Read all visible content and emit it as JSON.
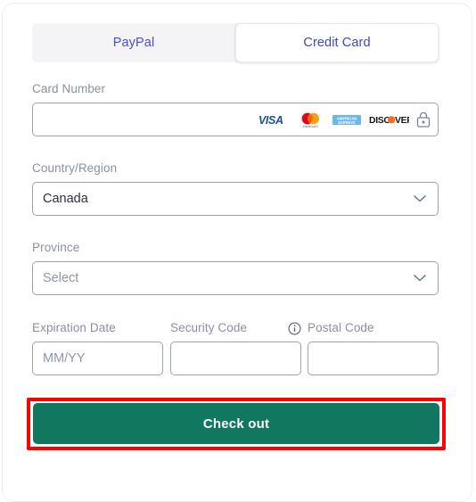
{
  "payment_form": {
    "tabs": [
      {
        "id": "paypal",
        "label": "PayPal",
        "active": false
      },
      {
        "id": "credit-card",
        "label": "Credit Card",
        "active": true
      }
    ],
    "fields": {
      "card_number": {
        "label": "Card Number",
        "value": "",
        "placeholder": "",
        "accepted_brands": [
          "VISA",
          "mastercard",
          "AMERICAN EXPRESS",
          "DISCOVER"
        ],
        "secure_icon": "lock-icon"
      },
      "country": {
        "label": "Country/Region",
        "value": "Canada",
        "is_placeholder": false
      },
      "province": {
        "label": "Province",
        "value": "Select",
        "is_placeholder": true
      },
      "expiration_date": {
        "label": "Expiration Date",
        "value": "",
        "placeholder": "MM/YY"
      },
      "security_code": {
        "label": "Security Code",
        "value": "",
        "placeholder": "",
        "info_icon": "info-icon"
      },
      "postal_code": {
        "label": "Postal Code",
        "value": "",
        "placeholder": ""
      }
    },
    "submit_button": {
      "label": "Check out"
    },
    "colors": {
      "tab_text": "#4a4ddb",
      "tab_track": "#f4f4f7",
      "label_text": "#8a8fa3",
      "input_border": "#9aa2b6",
      "checkout_bg": "#11785f",
      "checkout_text": "#ffffff",
      "highlight_border": "#fe0000"
    }
  }
}
